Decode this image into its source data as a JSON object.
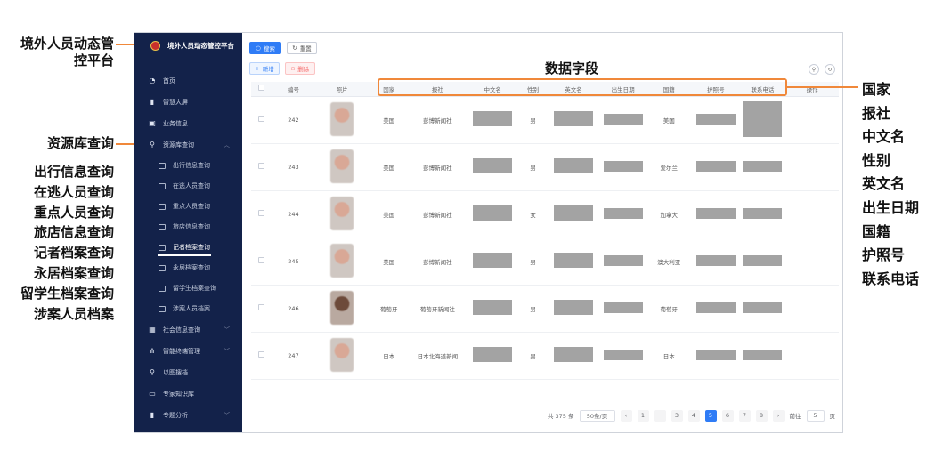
{
  "annotations": {
    "app_title": "境外人员动态管控平台",
    "resource_query": "资源库查询",
    "sub_items": [
      "出行信息查询",
      "在逃人员查询",
      "重点人员查询",
      "旅店信息查询",
      "记者档案查询",
      "永居档案查询",
      "留学生档案查询",
      "涉案人员档案"
    ],
    "data_fields_title": "数据字段",
    "data_fields": [
      "国家",
      "报社",
      "中文名",
      "性别",
      "英文名",
      "出生日期",
      "国籍",
      "护照号",
      "联系电话"
    ],
    "accent_color": "#f0883a"
  },
  "sidebar": {
    "brand": "境外人员动态管控平台",
    "items": [
      {
        "label": "首页",
        "icon": "dashboard-icon"
      },
      {
        "label": "智慧大屏",
        "icon": "bar-chart-icon"
      },
      {
        "label": "业务信息",
        "icon": "briefcase-icon"
      },
      {
        "label": "资源库查询",
        "icon": "search-icon"
      }
    ],
    "sub_items": [
      "出行信息查询",
      "在逃人员查询",
      "重点人员查询",
      "旅店信息查询",
      "记者档案查询",
      "永居档案查询",
      "留学生档案查询",
      "涉案人员档案"
    ],
    "bottom_items": [
      {
        "label": "社会信息查询",
        "icon": "database-icon"
      },
      {
        "label": "智能终端管理",
        "icon": "network-icon"
      },
      {
        "label": "以图搜档",
        "icon": "search-icon"
      },
      {
        "label": "专家知识库",
        "icon": "chat-icon"
      },
      {
        "label": "专题分析",
        "icon": "bar-chart-icon"
      }
    ]
  },
  "toolbar": {
    "search_label": "搜索",
    "reset_label": "重置",
    "add_label": "新增",
    "delete_label": "删除"
  },
  "table": {
    "columns": [
      "编号",
      "照片",
      "国家",
      "报社",
      "中文名",
      "性别",
      "英文名",
      "出生日期",
      "国籍",
      "护照号",
      "联系电话",
      "操作"
    ],
    "rows": [
      {
        "id": "242",
        "country": "美国",
        "newspaper": "彭博新闻社",
        "gender": "男",
        "nationality": "美国"
      },
      {
        "id": "243",
        "country": "美国",
        "newspaper": "彭博新闻社",
        "gender": "男",
        "nationality": "爱尔兰"
      },
      {
        "id": "244",
        "country": "美国",
        "newspaper": "彭博新闻社",
        "gender": "女",
        "nationality": "加拿大"
      },
      {
        "id": "245",
        "country": "美国",
        "newspaper": "彭博新闻社",
        "gender": "男",
        "nationality": "澳大利亚"
      },
      {
        "id": "246",
        "country": "葡萄牙",
        "newspaper": "葡萄牙新闻社",
        "gender": "男",
        "nationality": "葡萄牙"
      },
      {
        "id": "247",
        "country": "日本",
        "newspaper": "日本北海道新闻",
        "gender": "男",
        "nationality": "日本"
      }
    ]
  },
  "pagination": {
    "total": "共 375 条",
    "page_size": "50条/页",
    "pages": [
      "1",
      "···",
      "3",
      "4",
      "5",
      "6",
      "7",
      "8"
    ],
    "current": "5",
    "goto_label": "前往",
    "goto_value": "5",
    "page_unit": "页"
  }
}
